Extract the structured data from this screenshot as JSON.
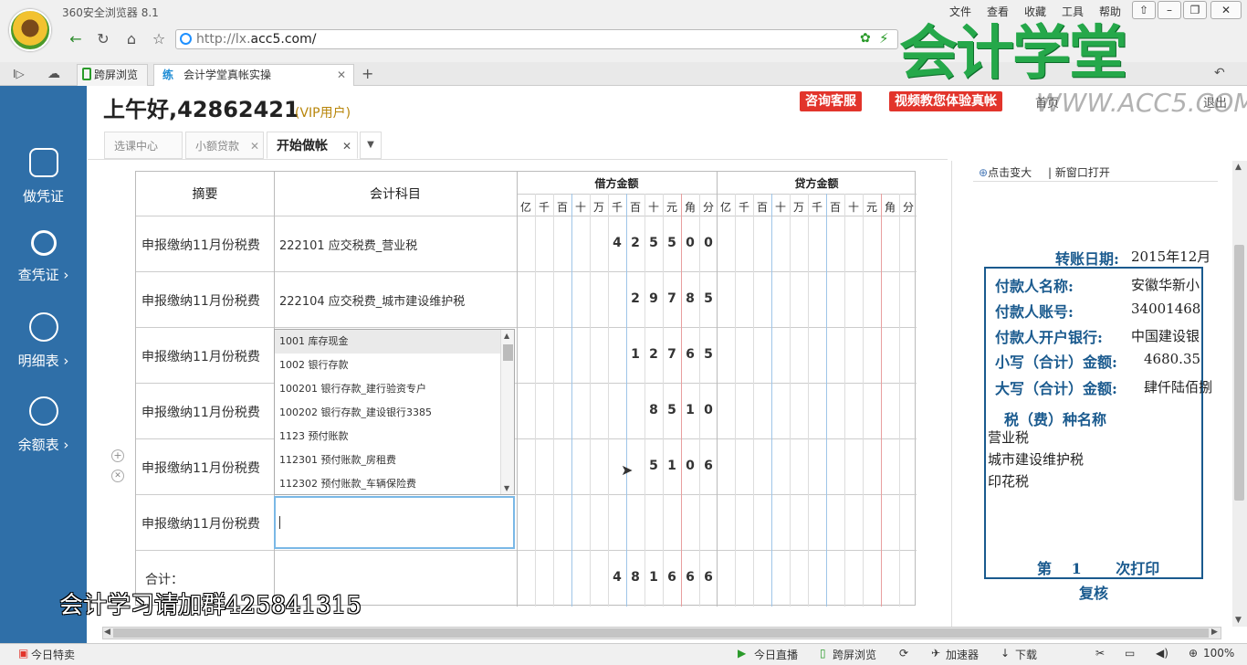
{
  "browser": {
    "app_title": "360安全浏览器 8.1",
    "menus": [
      "文件",
      "查看",
      "收藏",
      "工具",
      "帮助"
    ],
    "url_prefix": "http://lx.",
    "url_host": "acc5.com/",
    "tabs": [
      {
        "label": "跨屏浏览"
      },
      {
        "label": "会计学堂真帐实操"
      }
    ],
    "brand": "会计学堂",
    "brand_url": "WWW.ACC5.COM"
  },
  "sidebar": {
    "items": [
      {
        "label": "做凭证",
        "icon": "calculator-icon"
      },
      {
        "label": "查凭证 ›",
        "icon": "search-icon"
      },
      {
        "label": "明细表 ›",
        "icon": "list-icon"
      },
      {
        "label": "余额表 ›",
        "icon": "table-icon"
      }
    ]
  },
  "header": {
    "greeting": "上午好,42862421",
    "vip": "(VIP用户)",
    "buttons": [
      "咨询客服",
      "视频教您体验真帐"
    ],
    "links": [
      "首页",
      "退出"
    ]
  },
  "app_tabs": [
    {
      "label": "选课中心",
      "active": false
    },
    {
      "label": "小额贷款",
      "active": false
    },
    {
      "label": "开始做帐",
      "active": true
    }
  ],
  "voucher": {
    "headers": {
      "summary": "摘要",
      "subject": "会计科目",
      "debit": "借方金额",
      "credit": "贷方金额",
      "digits": [
        "亿",
        "千",
        "百",
        "十",
        "万",
        "千",
        "百",
        "十",
        "元",
        "角",
        "分"
      ]
    },
    "rows": [
      {
        "summary": "申报缴纳11月份税费",
        "subject": "222101 应交税费_营业税",
        "debit": "425500"
      },
      {
        "summary": "申报缴纳11月份税费",
        "subject": "222104 应交税费_城市建设维护税",
        "debit": "29785"
      },
      {
        "summary": "申报缴纳11月份税费",
        "subject": "",
        "debit": "12765"
      },
      {
        "summary": "申报缴纳11月份税费",
        "subject": "",
        "debit": "8510"
      },
      {
        "summary": "申报缴纳11月份税费",
        "subject": "",
        "debit": "5106"
      },
      {
        "summary": "申报缴纳11月份税费",
        "subject": "",
        "debit": ""
      }
    ],
    "total_label": "合计：",
    "total_debit": "481666",
    "dropdown": [
      "1001  库存现金",
      "1002  银行存款",
      "100201  银行存款_建行验资专户",
      "100202  银行存款_建设银行3385",
      "1123  预付账款",
      "112301  预付账款_房租费",
      "112302  预付账款_车辆保险费"
    ]
  },
  "preview": {
    "zoom_label": "点击变大",
    "new_window_label": "新窗口打开",
    "transfer_date_label": "转账日期:",
    "transfer_date_value": "2015年12月",
    "payer_name_label": "付款人名称:",
    "payer_name_value": "安徽华新小",
    "payer_account_label": "付款人账号:",
    "payer_account_value": "34001468",
    "payer_bank_label": "付款人开户银行:",
    "payer_bank_value": "中国建设银",
    "small_total_label": "小写（合计）金额:",
    "small_total_value": "4680.35",
    "big_total_label": "大写（合计）金额:",
    "big_total_value": "肆仟陆佰捌",
    "tax_type_label": "税（费）种名称",
    "tax_types": [
      "营业税",
      "城市建设维护税",
      "印花税"
    ],
    "print_label": "第　 1　　 次打印",
    "review_label": "复核"
  },
  "watermark": "会计学习请加群425841315",
  "bottom": {
    "left": "今日特卖",
    "items": [
      "今日直播",
      "跨屏浏览",
      "加速器",
      "下载"
    ],
    "zoom": "100%"
  }
}
